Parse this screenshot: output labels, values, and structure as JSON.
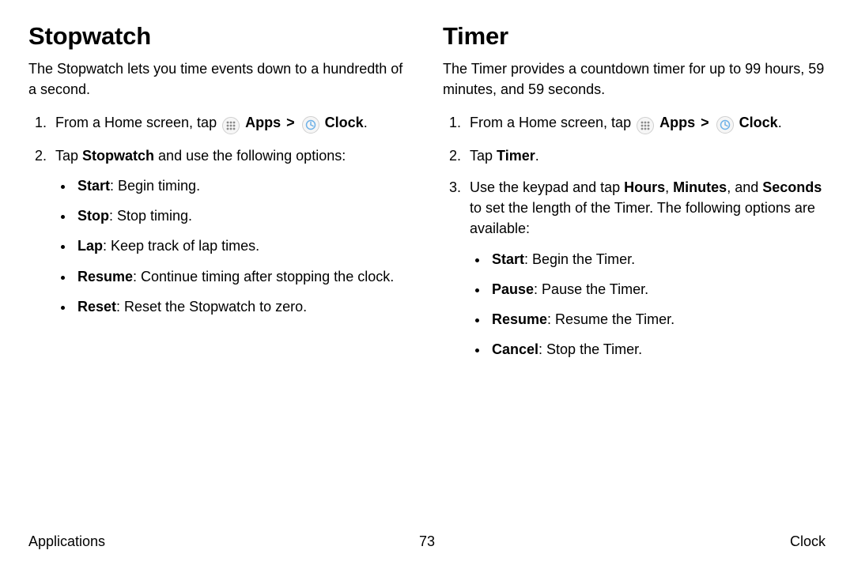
{
  "left": {
    "heading": "Stopwatch",
    "intro": "The Stopwatch lets you time events down to a hundredth of a second.",
    "step1_prefix": "From a Home screen, tap ",
    "apps_label": "Apps",
    "arrow": ">",
    "clock_label": "Clock",
    "step1_suffix": ".",
    "step2_prefix": "Tap ",
    "stopwatch_label": "Stopwatch",
    "step2_suffix": " and use the following options:",
    "options": [
      {
        "term": "Start",
        "desc": ": Begin timing."
      },
      {
        "term": "Stop",
        "desc": ": Stop timing."
      },
      {
        "term": "Lap",
        "desc": ": Keep track of lap times."
      },
      {
        "term": "Resume",
        "desc": ": Continue timing after stopping the clock."
      },
      {
        "term": "Reset",
        "desc": ": Reset the Stopwatch to zero."
      }
    ]
  },
  "right": {
    "heading": "Timer",
    "intro": "The Timer provides a countdown timer for up to 99 hours, 59 minutes, and 59 seconds.",
    "step1_prefix": "From a Home screen, tap ",
    "apps_label": "Apps",
    "arrow": ">",
    "clock_label": "Clock",
    "step1_suffix": ".",
    "step2_prefix": "Tap ",
    "timer_label": "Timer",
    "step2_suffix": ".",
    "step3_a": "Use the keypad and tap ",
    "step3_hours": "Hours",
    "step3_comma1": ", ",
    "step3_minutes": "Minutes",
    "step3_comma2": ", and ",
    "step3_seconds": "Seconds",
    "step3_b": " to set the length of the Timer. The following options are available:",
    "options": [
      {
        "term": "Start",
        "desc": ": Begin the Timer."
      },
      {
        "term": "Pause",
        "desc": ": Pause the Timer."
      },
      {
        "term": "Resume",
        "desc": ": Resume the Timer."
      },
      {
        "term": "Cancel",
        "desc": ": Stop the Timer."
      }
    ]
  },
  "footer": {
    "left": "Applications",
    "center": "73",
    "right": "Clock"
  },
  "icons": {
    "apps": "apps-icon",
    "clock": "clock-icon"
  }
}
